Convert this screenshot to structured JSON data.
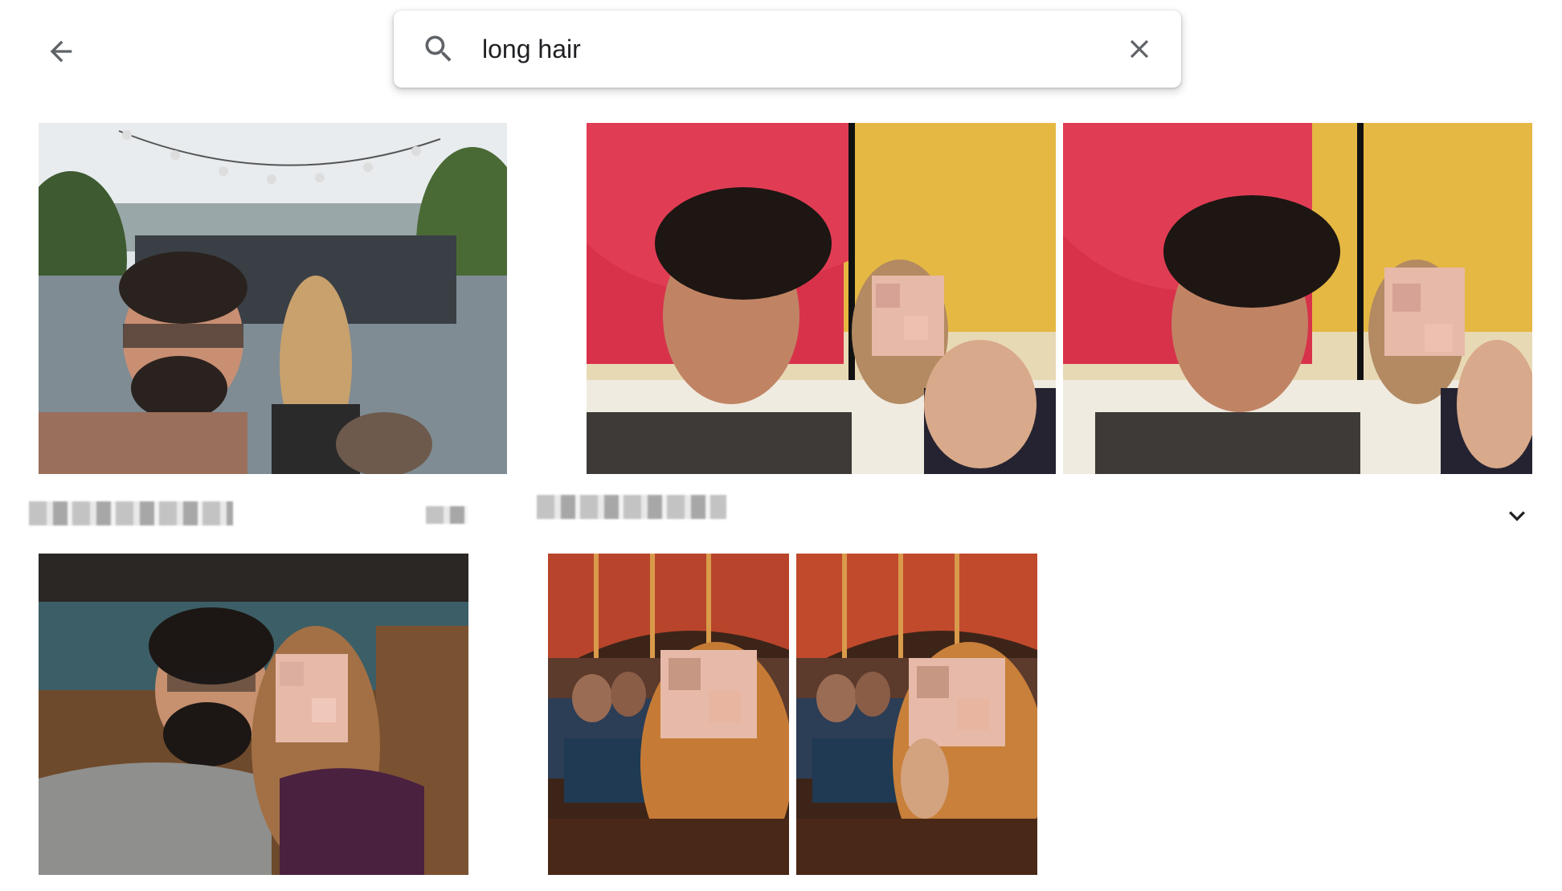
{
  "header": {
    "back_icon": "arrow-back-icon",
    "search": {
      "icon": "search-icon",
      "value": "long hair",
      "clear_icon": "close-icon"
    }
  },
  "sections": [
    {
      "expand_icon": "chevron-down-icon"
    }
  ],
  "colors": {
    "icon_gray": "#5f6368",
    "text_dark": "#202124",
    "background": "#ffffff"
  }
}
